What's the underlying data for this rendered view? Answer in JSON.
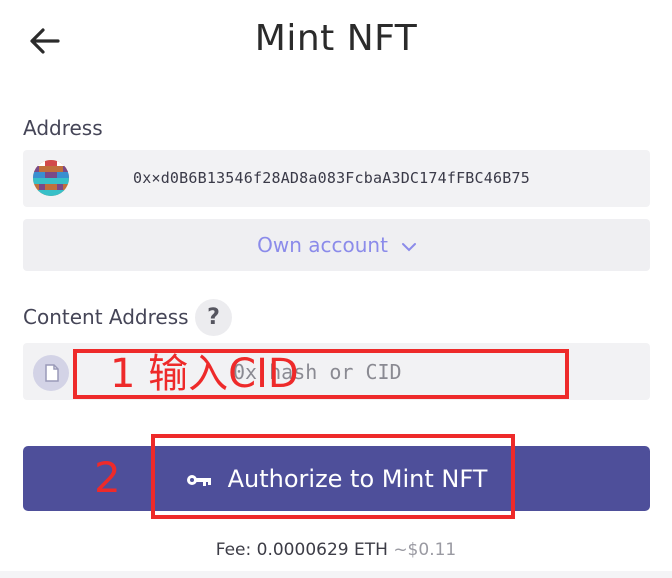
{
  "header": {
    "title": "Mint NFT",
    "back_icon": "arrow-left-icon"
  },
  "address_section": {
    "label": "Address",
    "value": "0x×d0B6B13546f28AD8a083FcbaA3DC174fFBC46B75",
    "account_selector": "Own account",
    "selector_icon": "chevron-down-icon"
  },
  "content_section": {
    "label": "Content Address",
    "help_icon_text": "?",
    "input_placeholder": "0x hash or CID"
  },
  "action": {
    "mint_button": "Authorize to Mint NFT",
    "button_icon": "key-icon"
  },
  "fee": {
    "label": "Fee: 0.0000629 ETH",
    "usd": "~$0.11"
  },
  "annotations": {
    "step1": "1 输入CID",
    "step2": "2"
  },
  "colors": {
    "accent": "#4e4f9a",
    "selector_text": "#8b8bea",
    "annotation_red": "#ee2a2a"
  }
}
